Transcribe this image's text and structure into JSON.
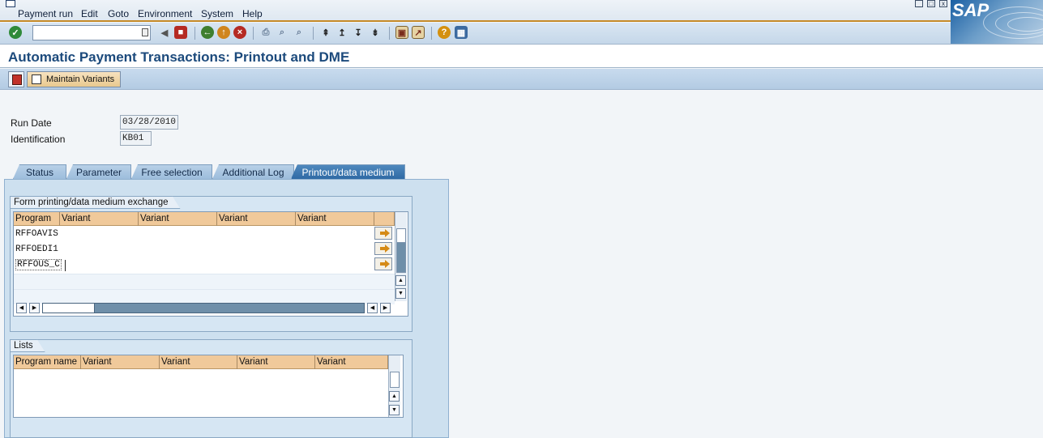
{
  "menu": {
    "items": [
      "Payment run",
      "Edit",
      "Goto",
      "Environment",
      "System",
      "Help"
    ]
  },
  "logo": "SAP",
  "toolbar": {
    "command_value": "",
    "icons": [
      "enter-icon",
      "command-field",
      "back-arrow-icon",
      "save-icon",
      "back-icon",
      "exit-icon",
      "cancel-icon",
      "print-icon",
      "find-icon",
      "find-next-icon",
      "first-page-icon",
      "previous-page-icon",
      "next-page-icon",
      "last-page-icon",
      "create-session-icon",
      "shortcut-icon",
      "help-icon",
      "layout-icon"
    ]
  },
  "title": "Automatic Payment Transactions: Printout and DME",
  "app_toolbar": {
    "maintain_variants": "Maintain Variants"
  },
  "header_fields": {
    "run_date_label": "Run Date",
    "run_date_value": "03/28/2010",
    "identification_label": "Identification",
    "identification_value": "KB01"
  },
  "tabs": [
    {
      "label": "Status",
      "active": false
    },
    {
      "label": "Parameter",
      "active": false
    },
    {
      "label": "Free selection",
      "active": false
    },
    {
      "label": "Additional Log",
      "active": false
    },
    {
      "label": "Printout/data medium",
      "active": true
    }
  ],
  "form_group": {
    "title": "Form printing/data medium exchange",
    "columns": [
      "Program",
      "Variant",
      "Variant",
      "Variant",
      "Variant"
    ],
    "rows": [
      {
        "program": "RFFOAVIS",
        "variants": [
          "",
          "",
          "",
          ""
        ]
      },
      {
        "program": "RFFOEDI1",
        "variants": [
          "",
          "",
          "",
          ""
        ]
      },
      {
        "program": "RFFOUS_C",
        "variants": [
          "",
          "",
          "",
          ""
        ]
      }
    ]
  },
  "lists_group": {
    "title": "Lists",
    "columns": [
      "Program name",
      "Variant",
      "Variant",
      "Variant",
      "Variant"
    ]
  },
  "colors": {
    "accent": "#1c4a7c",
    "header_cells": "#f0c99a",
    "active_tab": "#2f6aa5"
  }
}
